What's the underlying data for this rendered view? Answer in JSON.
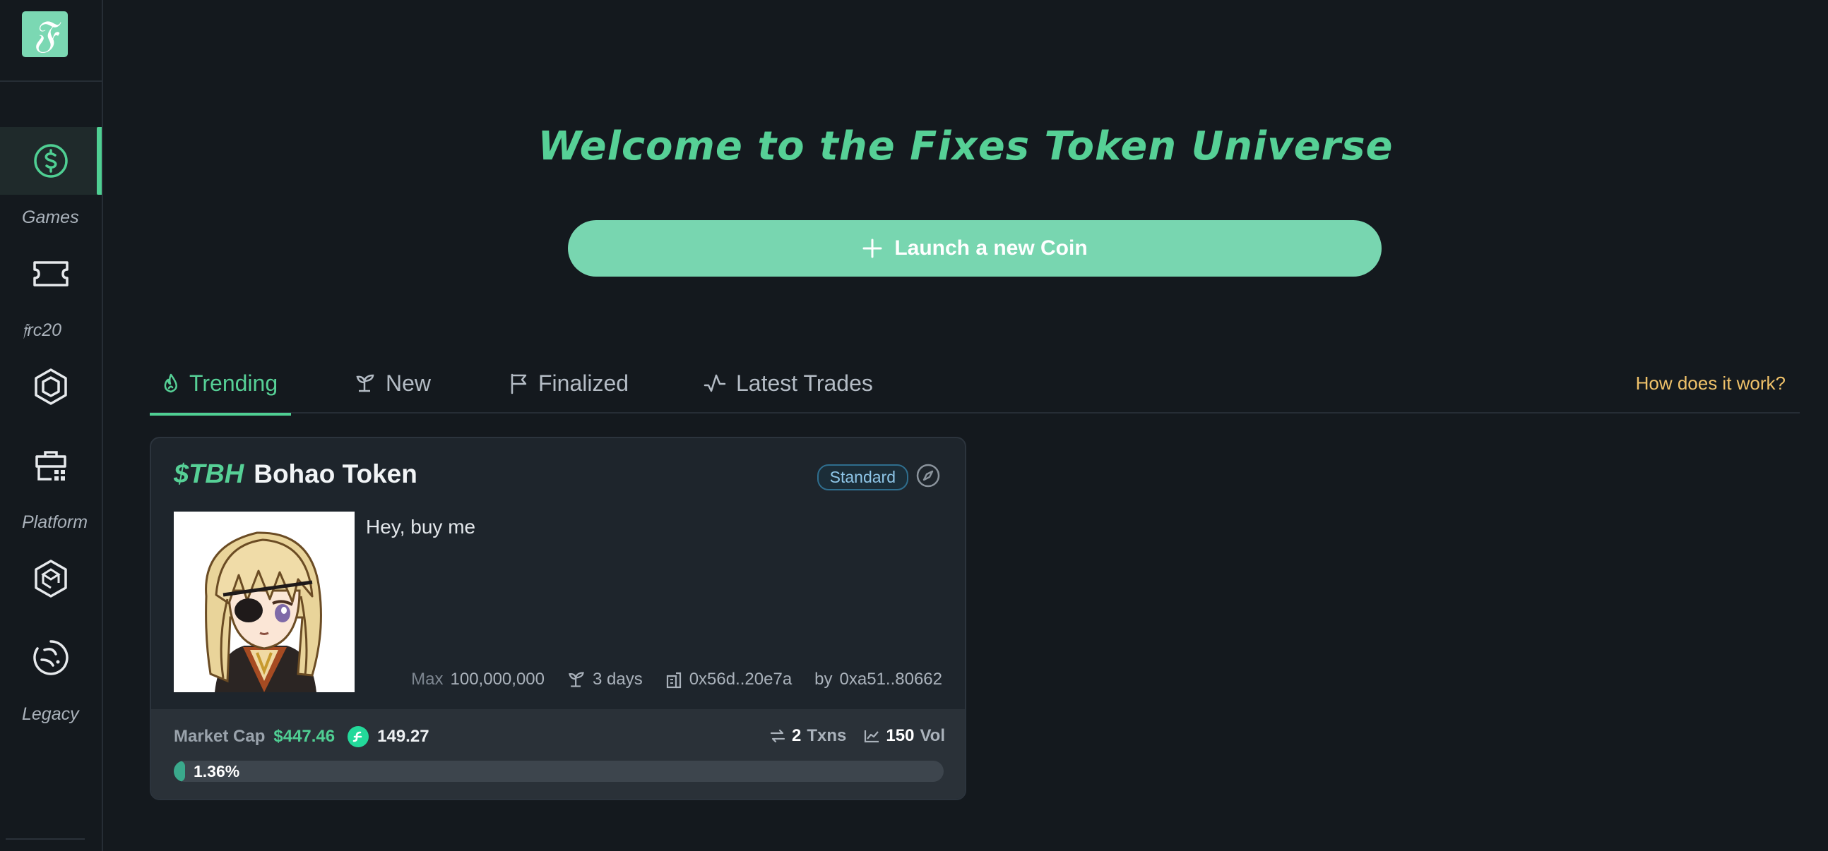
{
  "brand": {
    "logo_letter": "𝔉",
    "accent": "#56d096"
  },
  "sidebar": {
    "items": [
      {
        "name": "dollar-coin",
        "active": true
      },
      {
        "name": "ticket"
      },
      {
        "name": "hexagon"
      },
      {
        "name": "store"
      },
      {
        "name": "cube-badge"
      },
      {
        "name": "circle-swirl"
      }
    ],
    "sections": [
      "Games",
      "𝔣rc20",
      "Platform",
      "Legacy"
    ]
  },
  "hero": {
    "title": "Welcome to the Fixes Token Universe",
    "launch_label": "Launch a new Coin"
  },
  "tabs": [
    {
      "label": "Trending",
      "icon": "flame-icon",
      "active": true
    },
    {
      "label": "New",
      "icon": "sprout-icon"
    },
    {
      "label": "Finalized",
      "icon": "flag-icon"
    },
    {
      "label": "Latest Trades",
      "icon": "activity-icon"
    }
  ],
  "how_link": "How does it work?",
  "card": {
    "ticker": "$TBH",
    "name": "Bohao Token",
    "badge": "Standard",
    "description": "Hey, buy me",
    "max_label": "Max",
    "max_value": "100,000,000",
    "age": "3 days",
    "contract": "0x56d..20e7a",
    "creator_prefix": "by",
    "creator": "0xa51..80662",
    "market_cap_label": "Market Cap",
    "market_cap_value": "$447.46",
    "flow_amount": "149.27",
    "txns_count": "2",
    "txns_label": "Txns",
    "vol_value": "150",
    "vol_label": "Vol",
    "progress_text": "1.36%",
    "progress": 0.0136
  }
}
